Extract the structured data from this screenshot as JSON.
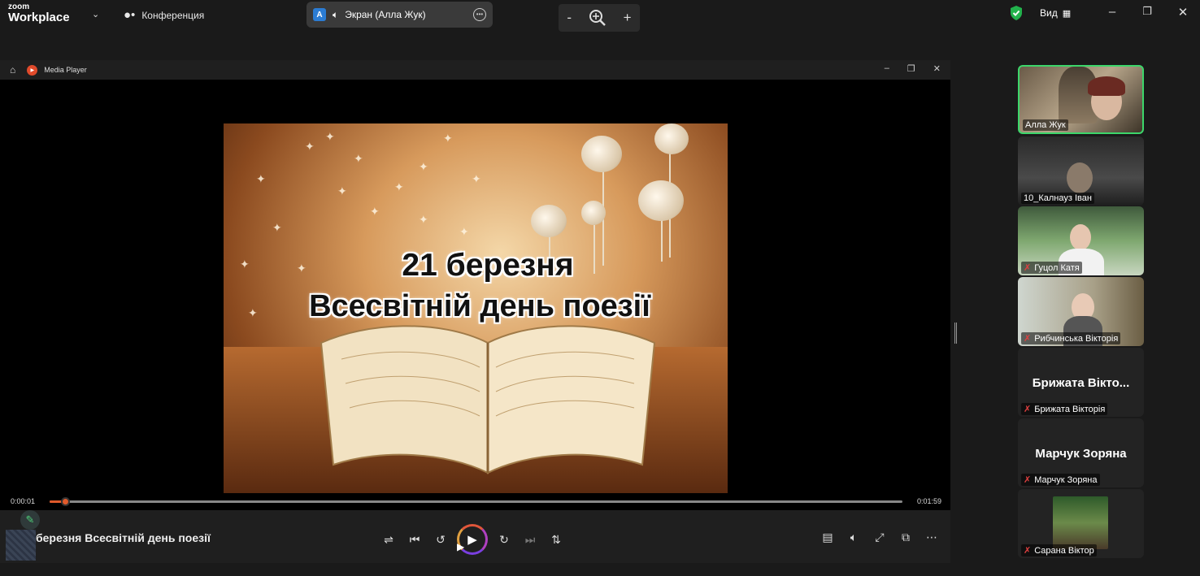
{
  "zoom": {
    "brand_small": "zoom",
    "brand_big": "Workplace",
    "meeting_label": "Конференция",
    "share_badge": "A",
    "share_label": "Экран (Алла Жук)",
    "view_label": "Вид",
    "zoom_out": "-",
    "zoom_in": "+"
  },
  "media_player": {
    "app_name": "Media Player",
    "video_line1": "21 березня",
    "video_line2": "Всесвітній день поезії",
    "current_time": "0:00:01",
    "total_time": "0:01:59",
    "progress_fraction": 0.016,
    "now_playing": "березня Всесвітній день поезії"
  },
  "participants": [
    {
      "name": "Алла Жук",
      "active": true,
      "muted": false
    },
    {
      "name": "10_Калнауз Іван",
      "active": false,
      "muted": false
    },
    {
      "name": "Гуцол Катя",
      "active": false,
      "muted": true
    },
    {
      "name": "Рибчинська Вікторія",
      "active": false,
      "muted": true
    },
    {
      "name": "Брижата Вікторія",
      "display": "Брижата Вікто...",
      "active": false,
      "muted": true
    },
    {
      "name": "Марчук Зоряна",
      "display": "Марчук Зоряна",
      "active": false,
      "muted": true
    },
    {
      "name": "Сарана Віктор",
      "active": false,
      "muted": true
    }
  ],
  "colors": {
    "accent": "#e05a2b",
    "active_border": "#3cd66a",
    "mute": "#e04040"
  }
}
